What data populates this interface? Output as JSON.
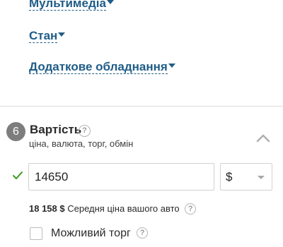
{
  "options": {
    "multimedia": "Мультимедіа",
    "state": "Стан",
    "extra_equipment": "Додаткове обладнання"
  },
  "section": {
    "step_number": "6",
    "title": "Вартість",
    "subtitle": "ціна, валюта, торг, обмін"
  },
  "price": {
    "value": "14650",
    "currency": "$"
  },
  "average": {
    "amount": "18 158 $",
    "label": "Середня ціна вашого авто"
  },
  "bargain": {
    "label": "Можливий торг",
    "checked": false
  },
  "help_glyph": "?",
  "colors": {
    "link": "#1f5c87",
    "check": "#3c9a1f",
    "badge": "#7d7d7d"
  }
}
